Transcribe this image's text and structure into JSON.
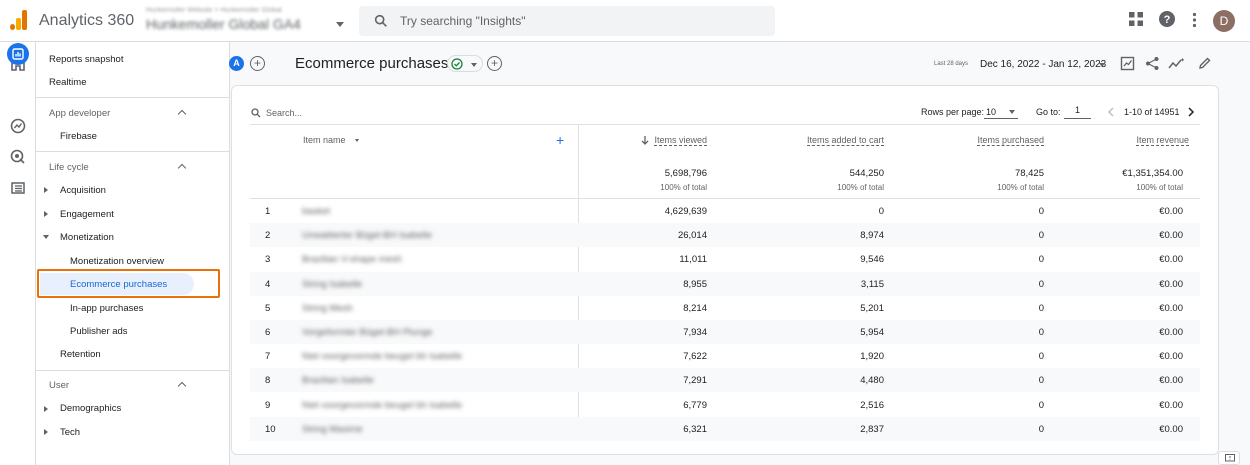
{
  "app": {
    "title": "Analytics 360",
    "avatar_letter": "D"
  },
  "account": {
    "breadcrumb": "Hunkemoller Website > Hunkemoller Global",
    "property": "Hunkemoller Global GA4"
  },
  "search": {
    "placeholder": "Try searching \"Insights\""
  },
  "nav": {
    "reports_snapshot": "Reports snapshot",
    "realtime": "Realtime",
    "app_developer": "App developer",
    "firebase": "Firebase",
    "life_cycle": "Life cycle",
    "acquisition": "Acquisition",
    "engagement": "Engagement",
    "monetization": "Monetization",
    "monetization_overview": "Monetization overview",
    "ecommerce_purchases": "Ecommerce purchases",
    "in_app_purchases": "In-app purchases",
    "publisher_ads": "Publisher ads",
    "retention": "Retention",
    "user": "User",
    "demographics": "Demographics",
    "tech": "Tech"
  },
  "report": {
    "comparison_chip": "A",
    "title": "Ecommerce purchases",
    "date_label": "Last 28 days",
    "date_range": "Dec 16, 2022 - Jan 12, 2023"
  },
  "table": {
    "search_placeholder": "Search...",
    "rows_per_page_label": "Rows per page:",
    "rows_per_page": "10",
    "goto_label": "Go to:",
    "goto_value": "1",
    "range": "1-10 of 14951",
    "columns": {
      "item_name": "Item name",
      "items_viewed": "Items viewed",
      "items_added": "Items added to cart",
      "items_purchased": "Items purchased",
      "item_revenue": "Item revenue"
    },
    "totals": {
      "items_viewed": "5,698,796",
      "items_added": "544,250",
      "items_purchased": "78,425",
      "item_revenue": "€1,351,354.00",
      "pct": "100% of total"
    },
    "rows": [
      {
        "idx": "1",
        "name": "basket",
        "viewed": "4,629,639",
        "added": "0",
        "purchased": "0",
        "revenue": "€0.00"
      },
      {
        "idx": "2",
        "name": "Unwattierter Bügel-BH Isabelle",
        "viewed": "26,014",
        "added": "8,974",
        "purchased": "0",
        "revenue": "€0.00"
      },
      {
        "idx": "3",
        "name": "Brazilian V-shape mesh",
        "viewed": "11,011",
        "added": "9,546",
        "purchased": "0",
        "revenue": "€0.00"
      },
      {
        "idx": "4",
        "name": "String Isabelle",
        "viewed": "8,955",
        "added": "3,115",
        "purchased": "0",
        "revenue": "€0.00"
      },
      {
        "idx": "5",
        "name": "String Mesh",
        "viewed": "8,214",
        "added": "5,201",
        "purchased": "0",
        "revenue": "€0.00"
      },
      {
        "idx": "6",
        "name": "Vorgeformter Bügel-BH Plunge",
        "viewed": "7,934",
        "added": "5,954",
        "purchased": "0",
        "revenue": "€0.00"
      },
      {
        "idx": "7",
        "name": "Niet voorgevormde beugel bh Isabelle",
        "viewed": "7,622",
        "added": "1,920",
        "purchased": "0",
        "revenue": "€0.00"
      },
      {
        "idx": "8",
        "name": "Brazilian Isabelle",
        "viewed": "7,291",
        "added": "4,480",
        "purchased": "0",
        "revenue": "€0.00"
      },
      {
        "idx": "9",
        "name": "Niet voorgevormde beugel bh Isabelle",
        "viewed": "6,779",
        "added": "2,516",
        "purchased": "0",
        "revenue": "€0.00"
      },
      {
        "idx": "10",
        "name": "String Maxime",
        "viewed": "6,321",
        "added": "2,837",
        "purchased": "0",
        "revenue": "€0.00"
      }
    ]
  },
  "colors": {
    "accent": "#1a73e8",
    "highlight": "#e8710a",
    "logo_orange": "#f9ab00",
    "logo_dark": "#e37400"
  }
}
